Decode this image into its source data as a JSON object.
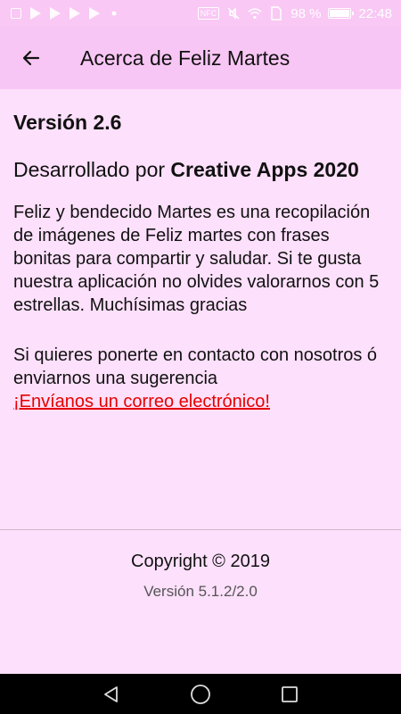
{
  "status_bar": {
    "battery_percent": "98 %",
    "time": "22:48",
    "nfc_label": "NFC",
    "left_icons": [
      "gallery-icon",
      "play-store-icon",
      "play-store-icon",
      "play-store-icon",
      "play-store-icon",
      "dot-icon"
    ],
    "right_icons": [
      "nfc-icon",
      "mute-icon",
      "wifi-icon",
      "sim-icon",
      "battery-icon"
    ]
  },
  "app_bar": {
    "title": "Acerca de Feliz Martes",
    "back_icon": "arrow-left-icon"
  },
  "content": {
    "version": "Versión 2.6",
    "developed_by_prefix": "Desarrollado por ",
    "developer": "Creative Apps 2020",
    "description": "Feliz y bendecido Martes es una recopilación de imágenes de Feliz martes con frases bonitas para compartir y saludar. Si te gusta nuestra aplicación no olvides valorarnos con 5 estrellas. Muchísimas gracias",
    "contact_text": "Si quieres ponerte en contacto con nosotros ó enviarnos una sugerencia",
    "contact_link": "¡Envíanos un correo electrónico!"
  },
  "footer": {
    "copyright": "Copyright © 2019",
    "build_version": "Versión 5.1.2/2.0"
  },
  "nav_bar": {
    "icons": [
      "back-triangle-icon",
      "home-circle-icon",
      "recents-square-icon"
    ]
  },
  "colors": {
    "background": "#fde0fb",
    "app_bar": "#f8c6f4",
    "link": "#e60000",
    "nav_bar": "#000000"
  }
}
